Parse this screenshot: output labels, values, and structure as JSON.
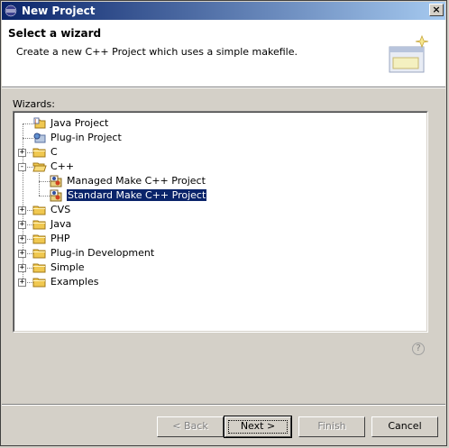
{
  "window": {
    "title": "New Project",
    "close_symbol": "×"
  },
  "header": {
    "title": "Select a wizard",
    "description": "Create a new C++ Project which uses a simple makefile."
  },
  "wizards": {
    "label": "Wizards:",
    "items": [
      {
        "label": "Java Project",
        "icon": "java-project-icon",
        "level": 0,
        "expander": "none"
      },
      {
        "label": "Plug-in Project",
        "icon": "plugin-project-icon",
        "level": 0,
        "expander": "none"
      },
      {
        "label": "C",
        "icon": "folder-icon",
        "level": 0,
        "expander": "+"
      },
      {
        "label": "C++",
        "icon": "folder-open-icon",
        "level": 0,
        "expander": "−"
      },
      {
        "label": "Managed Make C++ Project",
        "icon": "cpp-project-icon",
        "level": 1,
        "expander": "none"
      },
      {
        "label": "Standard Make C++ Project",
        "icon": "cpp-project-icon",
        "level": 1,
        "expander": "none",
        "selected": true
      },
      {
        "label": "CVS",
        "icon": "folder-icon",
        "level": 0,
        "expander": "+"
      },
      {
        "label": "Java",
        "icon": "folder-icon",
        "level": 0,
        "expander": "+"
      },
      {
        "label": "PHP",
        "icon": "folder-icon",
        "level": 0,
        "expander": "+"
      },
      {
        "label": "Plug-in Development",
        "icon": "folder-icon",
        "level": 0,
        "expander": "+"
      },
      {
        "label": "Simple",
        "icon": "folder-icon",
        "level": 0,
        "expander": "+"
      },
      {
        "label": "Examples",
        "icon": "folder-icon",
        "level": 0,
        "expander": "+"
      }
    ]
  },
  "help": {
    "symbol": "?"
  },
  "buttons": {
    "back": "< Back",
    "next": "Next >",
    "finish": "Finish",
    "cancel": "Cancel"
  },
  "colors": {
    "title_bar_start": "#0a246a",
    "title_bar_end": "#a6caf0",
    "selection": "#0a246a",
    "dialog_face": "#d4d0c8",
    "folder": "#f0c850"
  }
}
